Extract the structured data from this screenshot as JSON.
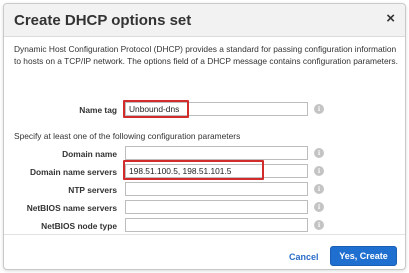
{
  "dialog": {
    "title": "Create DHCP options set",
    "close_glyph": "×",
    "description": "Dynamic Host Configuration Protocol (DHCP) provides a standard for passing configuration information to hosts on a TCP/IP network. The options field of a DHCP message contains configuration parameters."
  },
  "name_tag": {
    "label": "Name tag",
    "value": "Unbound-dns"
  },
  "config": {
    "instruction": "Specify at least one of the following configuration parameters",
    "fields": [
      {
        "label": "Domain name",
        "value": ""
      },
      {
        "label": "Domain name servers",
        "value": "198.51.100.5, 198.51.101.5"
      },
      {
        "label": "NTP servers",
        "value": ""
      },
      {
        "label": "NetBIOS name servers",
        "value": ""
      },
      {
        "label": "NetBIOS node type",
        "value": ""
      }
    ]
  },
  "icons": {
    "close": "close-icon",
    "info": "info-icon",
    "info_glyph": "i"
  },
  "footer": {
    "cancel_label": "Cancel",
    "create_label": "Yes, Create"
  },
  "colors": {
    "highlight": "#d12b2b",
    "primary": "#1f6fd0",
    "link": "#2a6cc6"
  }
}
